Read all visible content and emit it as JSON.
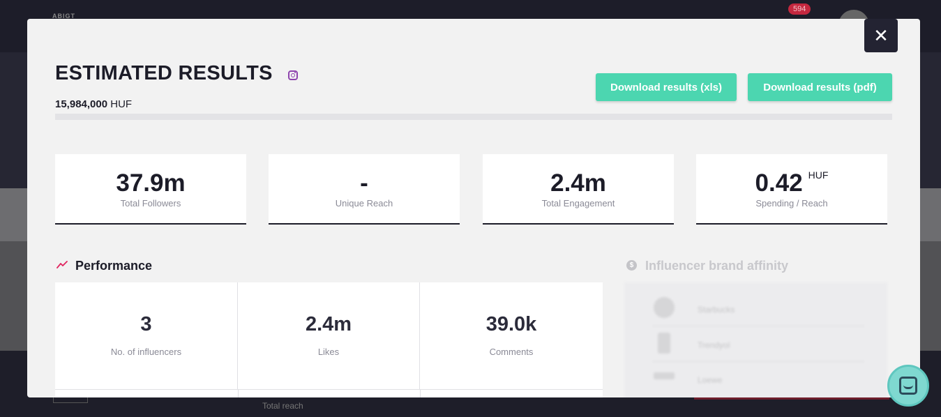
{
  "background": {
    "logo_text": "ABIGT",
    "notification_count": "594",
    "total_reach_label": "Total reach"
  },
  "modal": {
    "title": "ESTIMATED RESULTS",
    "platform_icon": "instagram-icon",
    "budget_value": "15,984,000",
    "budget_currency": "HUF",
    "download_xls": "Download results (xls)",
    "download_pdf": "Download results (pdf)",
    "close_icon": "close-icon"
  },
  "stats": [
    {
      "value": "37.9m",
      "label": "Total Followers",
      "unit": ""
    },
    {
      "value": "-",
      "label": "Unique Reach",
      "unit": ""
    },
    {
      "value": "2.4m",
      "label": "Total Engagement",
      "unit": ""
    },
    {
      "value": "0.42",
      "label": "Spending / Reach",
      "unit": "HUF"
    }
  ],
  "performance": {
    "title": "Performance",
    "icon": "trend-line-icon",
    "cells": [
      {
        "value": "3",
        "label": "No. of influencers"
      },
      {
        "value": "2.4m",
        "label": "Likes"
      },
      {
        "value": "39.0k",
        "label": "Comments"
      }
    ]
  },
  "affinity": {
    "title": "Influencer brand affinity",
    "icon": "dollar-icon",
    "brands": [
      {
        "name": "Starbucks"
      },
      {
        "name": "Trendyol"
      },
      {
        "name": "Loewe"
      }
    ]
  },
  "colors": {
    "accent": "#4cd6b0",
    "dark": "#1c1c28",
    "instagram": "#8e44ad",
    "trend": "#e0245e"
  }
}
